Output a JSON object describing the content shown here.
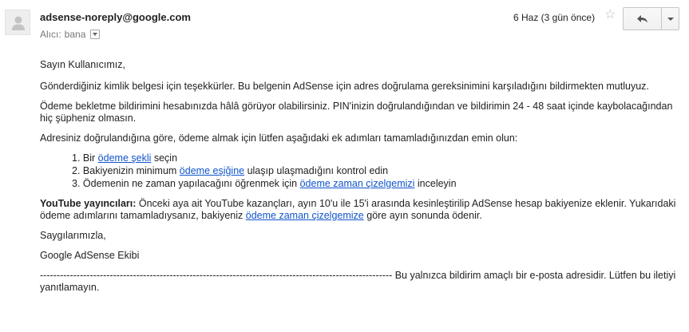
{
  "header": {
    "sender": "adsense-noreply@google.com",
    "recipient_label": "Alıcı:",
    "recipient": "bana",
    "date": "6 Haz (3 gün önce)",
    "star": "☆"
  },
  "icons": {
    "avatar": "person-placeholder-icon",
    "reply": "reply-arrow-icon",
    "more": "chevron-down-icon",
    "star": "star-outline-icon"
  },
  "colors": {
    "link": "#1155cc",
    "text": "#222222",
    "muted": "#777777"
  },
  "body": {
    "greeting": "Sayın Kullanıcımız,",
    "p1": "Gönderdiğiniz kimlik belgesi için teşekkürler. Bu belgenin AdSense için adres doğrulama gereksinimini karşıladığını bildirmekten mutluyuz.",
    "p2": "Ödeme bekletme bildirimini hesabınızda hâlâ görüyor olabilirsiniz. PIN'inizin doğrulandığından ve bildirimin 24 - 48 saat içinde kaybolacağından hiç şüpheniz olmasın.",
    "p3": "Adresiniz doğrulandığına göre, ödeme almak için lütfen aşağıdaki ek adımları tamamladığınızdan emin olun:",
    "steps": [
      {
        "num": "1.",
        "before": "Bir ",
        "link": "ödeme şekli",
        "after": " seçin"
      },
      {
        "num": "2.",
        "before": "Bakiyenizin minimum ",
        "link": "ödeme eşiğine",
        "after": " ulaşıp ulaşmadığını kontrol edin"
      },
      {
        "num": "3.",
        "before": "Ödemenin ne zaman yapılacağını öğrenmek için ",
        "link": "ödeme zaman çizelgemizi",
        "after": " inceleyin"
      }
    ],
    "youtube_label": "YouTube yayıncıları:",
    "youtube_text_before": " Önceki aya ait YouTube kazançları, ayın 10'u ile 15'i arasında kesinleştirilip AdSense hesap bakiyenize eklenir. Yukarıdaki ödeme adımlarını tamamladıysanız, bakiyeniz ",
    "youtube_link": "ödeme zaman çizelgemize",
    "youtube_text_after": " göre ayın sonunda ödenir.",
    "closing": "Saygılarımızla,",
    "signature": "Google AdSense Ekibi",
    "divider": "----------------------------------------------------------------------------------------------------------",
    "footer": " Bu yalnızca bildirim amaçlı bir e-posta adresidir. Lütfen bu iletiyi yanıtlamayın."
  }
}
